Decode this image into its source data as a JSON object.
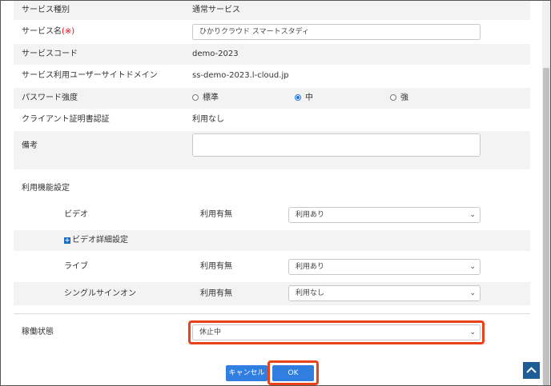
{
  "form": {
    "service_type": {
      "label": "サービス種別",
      "value": "通常サービス"
    },
    "service_name": {
      "label": "サービス名",
      "required_mark": "(※)",
      "value": "ひかりクラウド スマートスタディ"
    },
    "service_code": {
      "label": "サービスコード",
      "value": "demo-2023"
    },
    "user_site_domain": {
      "label": "サービス利用ユーザーサイトドメイン",
      "value": "ss-demo-2023.l-cloud.jp"
    },
    "password_strength": {
      "label": "パスワード強度",
      "options": [
        "標準",
        "中",
        "強"
      ],
      "selected": "中"
    },
    "client_cert": {
      "label": "クライアント証明書認証",
      "value": "利用なし"
    },
    "notes": {
      "label": "備考",
      "value": ""
    }
  },
  "features": {
    "section_label": "利用機能設定",
    "video": {
      "label": "ビデオ",
      "sub_label": "利用有無",
      "value": "利用あり"
    },
    "video_detail": {
      "label": "ビデオ詳細設定",
      "expand_glyph": "+"
    },
    "live": {
      "label": "ライブ",
      "sub_label": "利用有無",
      "value": "利用あり"
    },
    "sso": {
      "label": "シングルサインオン",
      "sub_label": "利用有無",
      "value": "利用なし"
    }
  },
  "operation": {
    "label": "稼働状態",
    "value": "休止中"
  },
  "buttons": {
    "cancel": "キャンセル",
    "ok": "OK"
  },
  "icons": {
    "select_chevron": "⌄",
    "to_top": "chevron-up-icon"
  },
  "colors": {
    "accent": "#2f7ee0",
    "highlight": "#e8421b",
    "required": "#e60012",
    "to_top_bg": "#1f5d96"
  }
}
